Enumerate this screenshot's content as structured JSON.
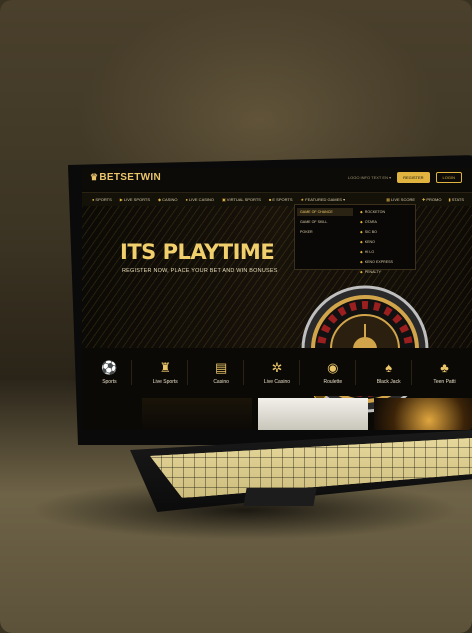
{
  "brand": {
    "name": "BETSETWIN"
  },
  "topbar": {
    "language": "LOGO INFO TEXT  EN ▾",
    "register_label": "REGISTER",
    "login_label": "LOGIN"
  },
  "nav": {
    "items": [
      {
        "label": "SPORTS",
        "icon": "soccer-ball-icon"
      },
      {
        "label": "LIVE SPORTS",
        "icon": "live-icon"
      },
      {
        "label": "CASINO",
        "icon": "casino-icon"
      },
      {
        "label": "LIVE CASINO",
        "icon": "live-casino-icon"
      },
      {
        "label": "VIRTUAL SPORTS",
        "icon": "virtual-icon"
      },
      {
        "label": "E SPORTS",
        "icon": "esports-icon"
      },
      {
        "label": "FEATURED GAMES ▾",
        "icon": "star-icon"
      }
    ],
    "right": [
      {
        "label": "LIVE SCORE",
        "icon": "score-icon"
      },
      {
        "label": "PROMO",
        "icon": "gift-icon"
      },
      {
        "label": "STATS",
        "icon": "stats-icon"
      }
    ]
  },
  "dropdown": {
    "left": [
      {
        "label": "GAME OF CHANCE",
        "active": true
      },
      {
        "label": "GAME OF SKILL",
        "active": false
      },
      {
        "label": "POKER",
        "active": false
      }
    ],
    "right": [
      "ROCKETON",
      "OTARA",
      "SIC BO",
      "KENO",
      "HI LO",
      "KENO EXPRESS",
      "PENALTY"
    ]
  },
  "hero": {
    "title": "ITS PLAYTIME",
    "subtitle": "REGISTER NOW, PLACE YOUR BET AND WIN BONUSES"
  },
  "categories": [
    {
      "label": "Sports",
      "icon": "soccer-ball-icon"
    },
    {
      "label": "Live Sports",
      "icon": "trophy-icon"
    },
    {
      "label": "Casino",
      "icon": "slot-machine-icon"
    },
    {
      "label": "Live Casino",
      "icon": "poker-chip-icon"
    },
    {
      "label": "Roulette",
      "icon": "roulette-icon"
    },
    {
      "label": "Black Jack",
      "icon": "cards-icon"
    },
    {
      "label": "Teen Patti",
      "icon": "cards-fan-icon"
    }
  ],
  "colors": {
    "accent": "#e0b43f",
    "background": "#0b0905"
  }
}
